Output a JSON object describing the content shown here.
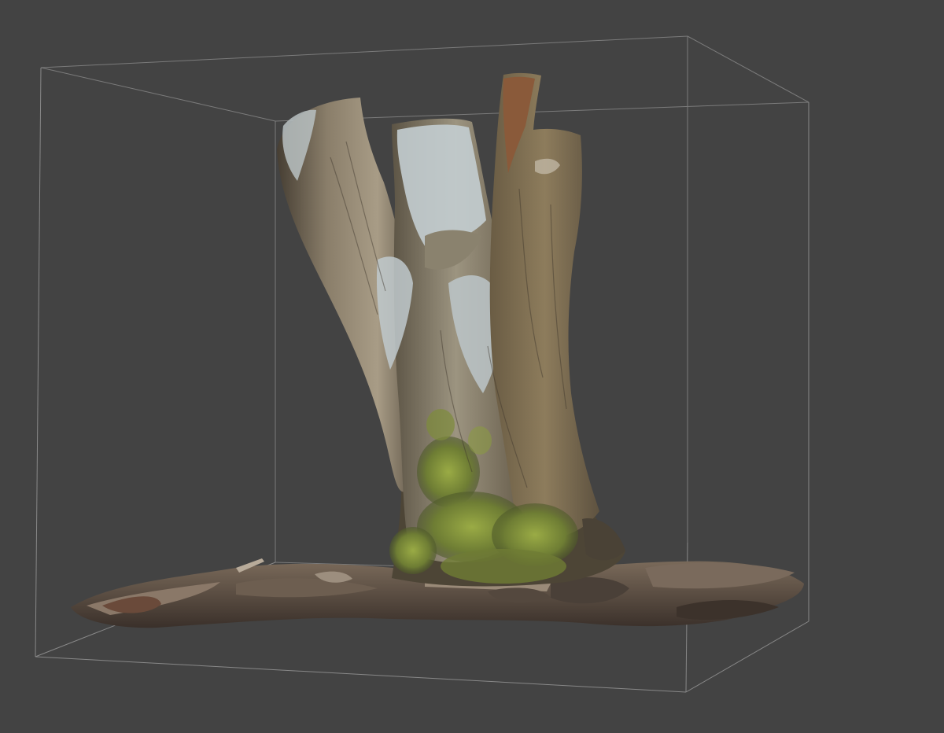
{
  "viewport": {
    "background_color": "#434343",
    "bounding_box_color": "#9a9a9a",
    "model": "tree-stump-scan"
  },
  "palette": {
    "bark_dark": "#4f4638",
    "bark_mid": "#7d7260",
    "bark_light": "#a89d8a",
    "lichen": "#c6cfd2",
    "moss": "#7f8d3a",
    "moss_light": "#a2b04a",
    "debris": "#5a4c40",
    "cut_top": "#8a5a3a"
  }
}
